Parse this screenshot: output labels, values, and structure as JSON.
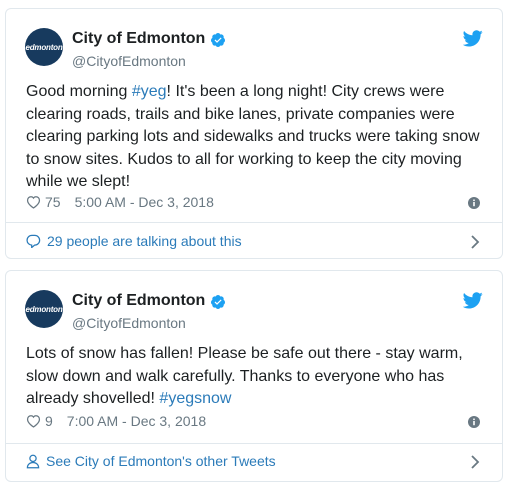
{
  "tweets": [
    {
      "avatar_text": "edmonton",
      "display_name": "City of Edmonton",
      "handle": "@CityofEdmonton",
      "text_parts": [
        "Good morning ",
        "#yeg",
        "! It's been a long night! City crews were clearing roads, trails and bike lanes, private companies were clearing parking lots and sidewalks and trucks were taking snow to snow sites. Kudos to all for working to keep the city moving while we slept!"
      ],
      "likes": "75",
      "timestamp": "5:00 AM - Dec 3, 2018",
      "footer_link": "29 people are talking about this",
      "footer_icon": "speech-bubble-icon"
    },
    {
      "avatar_text": "edmonton",
      "display_name": "City of Edmonton",
      "handle": "@CityofEdmonton",
      "text_parts": [
        "Lots of snow has fallen! Please be safe out there - stay warm, slow down and walk carefully. Thanks to everyone who has already shovelled! ",
        "#yegsnow"
      ],
      "likes": "9",
      "timestamp": "7:00 AM - Dec 3, 2018",
      "footer_link": "See City of Edmonton's other Tweets",
      "footer_icon": "person-icon"
    }
  ],
  "colors": {
    "link": "#2b7bb9",
    "secondary_text": "#697882",
    "border": "#e1e8ed",
    "verified": "#1da1f2",
    "avatar_bg": "#173a5e"
  }
}
